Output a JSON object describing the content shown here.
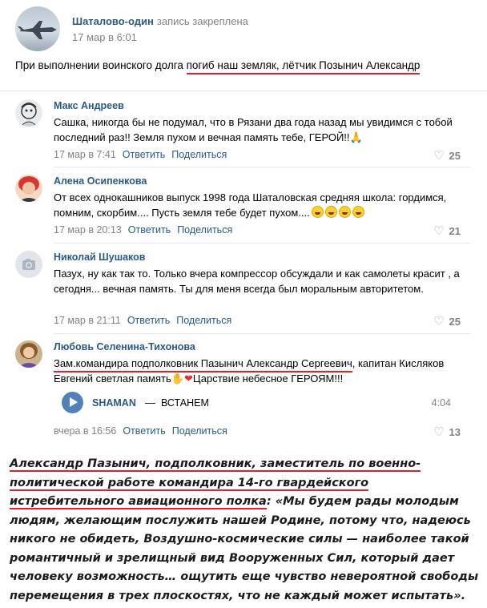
{
  "post": {
    "author": "Шаталово-один",
    "author_note": "запись закреплена",
    "date": "17 мар в 6:01",
    "text_prefix": "При выполнении воинского долга ",
    "text_highlight": "погиб наш земляк, лётчик Позынич Александр"
  },
  "comments": [
    {
      "name": "Макс Андреев",
      "text": "Сашка, никогда бы не подумал, что в Рязани два года назад мы увидимся с тобой последний раз!! Земля пухом и вечная память тебе, ГЕРОЙ!!",
      "emoji": "🙏",
      "date": "17 мар в 7:41",
      "reply": "Ответить",
      "share": "Поделиться",
      "likes": "25",
      "avatar_icon": "drawing-avatar-icon"
    },
    {
      "name": "Алена Осипенкова",
      "text": "От всех однокашников выпуск 1998 года Шаталовская средняя школа: гордимся, помним, скорбим.... Пусть земля тебе будет пухом....",
      "date": "17 мар в 20:13",
      "reply": "Ответить",
      "share": "Поделиться",
      "likes": "21",
      "avatar_icon": "woman-avatar-icon"
    },
    {
      "name": "Николай Шушаков",
      "text": "Пазух, ну как так то. Только вчера компрессор обсуждали и как самолеты красит , а сегодня... вечная память. Ты для меня всегда был моральным авторитетом.",
      "date": "17 мар в 21:11",
      "reply": "Ответить",
      "share": "Поделиться",
      "likes": "25",
      "avatar_icon": "camera-placeholder-icon"
    },
    {
      "name": "Любовь Селенина-Тихонова",
      "text_highlight": "Зам.командира подполковник Пазынич Александр Сергеевич",
      "text_rest": ", капитан Кисляков Евгений светлая память",
      "text_end": "Царствие небесное ГЕРОЯМ!!!",
      "date": "вчера в 16:56",
      "reply": "Ответить",
      "share": "Поделиться",
      "likes": "13",
      "avatar_icon": "woman-avatar-icon"
    }
  ],
  "audio": {
    "artist": "SHAMAN",
    "separator": "—",
    "title": "ВСТАНЕМ",
    "duration": "4:04"
  },
  "article": {
    "highlight": "Александр Пазынич, подполковник, заместитель по военно-политической работе командира 14-го гвардейского истребительного авиационного полка",
    "rest": ": «Мы будем рады молодым людям, желающим послужить нашей Родине, потому что, надеюсь никого не обидеть, Воздушно-космические силы — наиболее такой романтичный и зрелищный вид Вооруженных Сил, который дает человеку возможность… ощутить еще чувство невероятной свободы перемещения в трех плоскостях, что не каждый может испытать»."
  },
  "colors": {
    "link": "#2a5885",
    "meta": "#828282",
    "play": "#5181b8",
    "underline": "#e0202a"
  }
}
